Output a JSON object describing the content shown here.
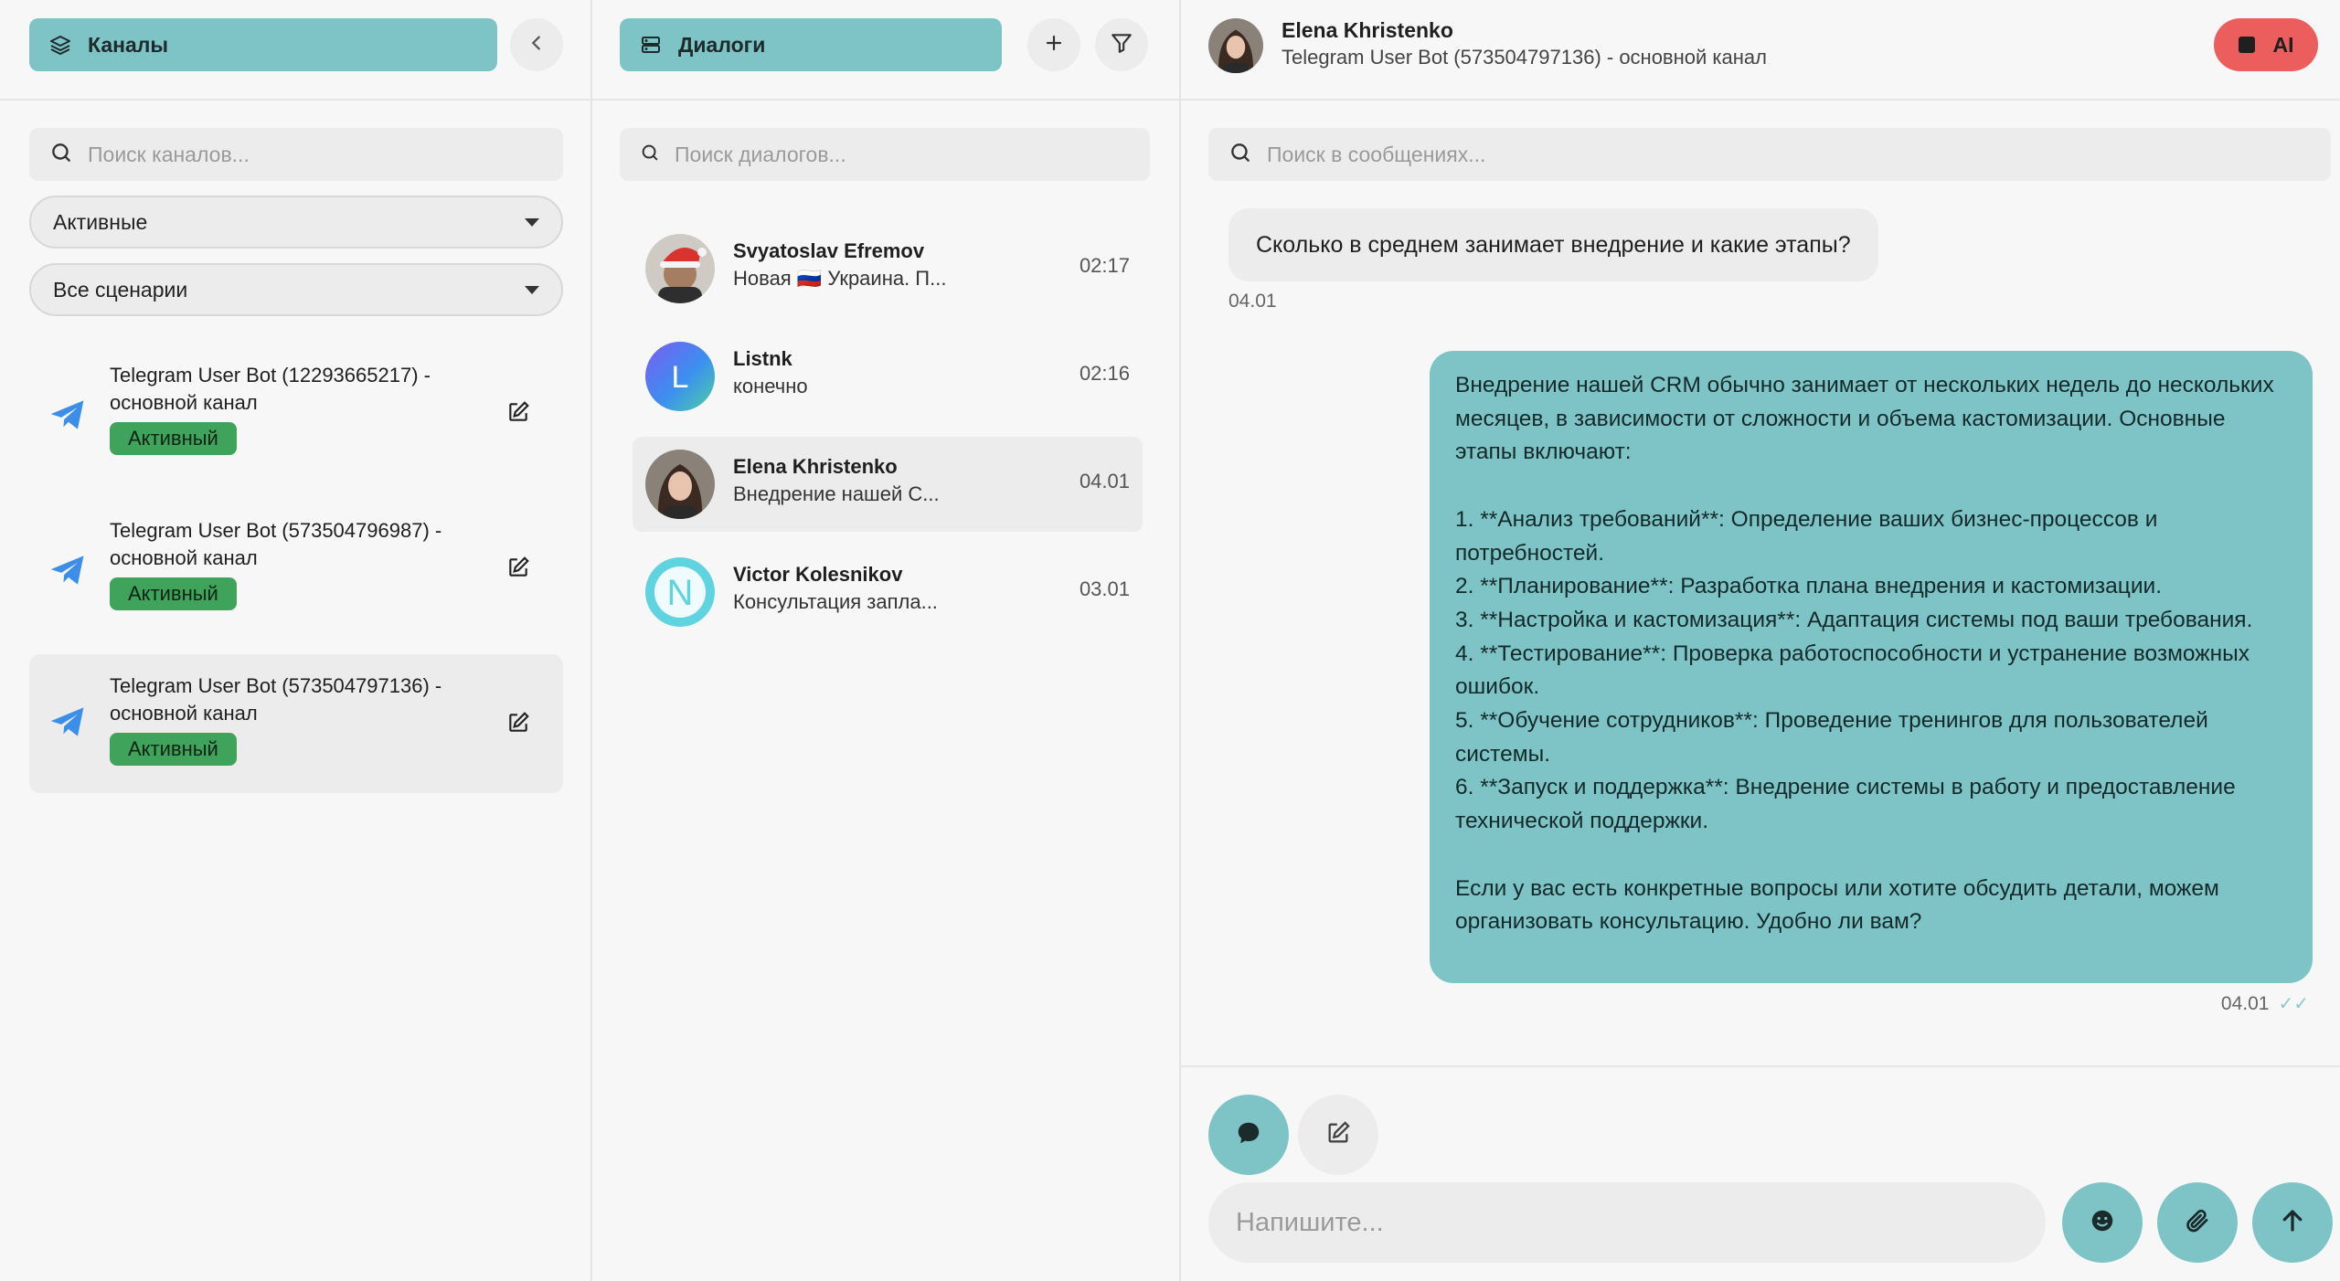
{
  "channels_panel": {
    "header_label": "Каналы",
    "search_placeholder": "Поиск каналов...",
    "status_filter": "Активные",
    "scenario_filter": "Все сценарии",
    "items": [
      {
        "title": "Telegram User Bot (12293665217) - основной канал",
        "status": "Активный",
        "active": false
      },
      {
        "title": "Telegram User Bot (573504796987) - основной канал",
        "status": "Активный",
        "active": false
      },
      {
        "title": "Telegram User Bot (573504797136) - основной канал",
        "status": "Активный",
        "active": true
      }
    ]
  },
  "dialogs_panel": {
    "header_label": "Диалоги",
    "search_placeholder": "Поиск диалогов...",
    "items": [
      {
        "name": "Svyatoslav Efremov",
        "preview": "Новая 🇷🇺 Украина. П...",
        "time": "02:17",
        "avatar": "photo-santa-hat"
      },
      {
        "name": "Listnk",
        "preview": "конечно",
        "time": "02:16",
        "avatar": "letter-L"
      },
      {
        "name": "Elena Khristenko",
        "preview": "Внедрение нашей С...",
        "time": "04.01",
        "avatar": "photo-woman"
      },
      {
        "name": "Victor Kolesnikov",
        "preview": "Консультация запла...",
        "time": "03.01",
        "avatar": "letter-N"
      }
    ]
  },
  "chat": {
    "contact_name": "Elena Khristenko",
    "channel": "Telegram User Bot (573504797136) - основной канал",
    "ai_label": "AI",
    "search_placeholder": "Поиск в сообщениях...",
    "messages": [
      {
        "direction": "in",
        "text": "Сколько в среднем занимает внедрение и какие этапы?",
        "time": "04.01"
      },
      {
        "direction": "out",
        "text": "Внедрение нашей CRM обычно занимает от нескольких недель до нескольких месяцев, в зависимости от сложности и объема кастомизации. Основные этапы включают:\n\n1. **Анализ требований**: Определение ваших бизнес-процессов и потребностей.\n2. **Планирование**: Разработка плана внедрения и кастомизации.\n3. **Настройка и кастомизация**: Адаптация системы под ваши требования.\n4. **Тестирование**: Проверка работоспособности и устранение возможных ошибок.\n5. **Обучение сотрудников**: Проведение тренингов для пользователей системы.\n6. **Запуск и поддержка**: Внедрение системы в работу и предоставление технической поддержки.\n\nЕсли у вас есть конкретные вопросы или хотите обсудить детали, можем организовать консультацию. Удобно ли вам?",
        "time": "04.01",
        "status": "read"
      }
    ],
    "composer_placeholder": "Напишите..."
  },
  "colors": {
    "accent": "#7ec4c7",
    "badge": "#3fa35c",
    "ai_button": "#ec5d5d",
    "telegram": "#3d8ee8"
  }
}
